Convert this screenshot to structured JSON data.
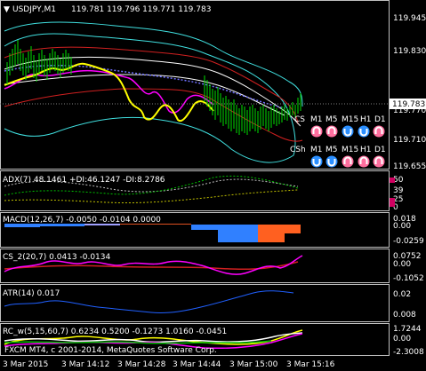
{
  "header": {
    "symbol": "USDJPY,M1",
    "ohlc": "119.781 119.796 119.771 119.783"
  },
  "price_axis": {
    "ticks": [
      "119.945",
      "119.830",
      "119.770",
      "119.710",
      "119.655"
    ],
    "current_price": "119.783",
    "current_price_bg": "#ffffff"
  },
  "indicator_panel": {
    "cs_label": "CS",
    "csh_label": "CSh",
    "timeframes": [
      "M1",
      "M5",
      "M15",
      "H1",
      "D1"
    ],
    "cs_arrows": [
      "up",
      "up",
      "down",
      "down",
      "up"
    ],
    "csh_arrows": [
      "down",
      "down",
      "up",
      "up",
      "up"
    ],
    "up_color": "#ff6e9e",
    "down_color": "#2b8fff"
  },
  "subwindows": {
    "adx": {
      "label": "ADX(7) 48.1461 +DI:46.1247 -DI:8.2786",
      "ticks": [
        "50",
        "39",
        "25",
        "0"
      ]
    },
    "macd": {
      "label": "MACD(12,26,7) -0.0050 -0.0104 0.0000",
      "ticks": [
        "0.018",
        "0.00",
        "-0.0259"
      ]
    },
    "cs": {
      "label": "CS_2(20,7) 0.0413 -0.0134",
      "ticks": [
        "0.0752",
        "0.00",
        "-0.1052"
      ]
    },
    "atr": {
      "label": "ATR(14) 0.017",
      "ticks": [
        "0.02",
        "0.008"
      ]
    },
    "rc": {
      "label": "RC_w(5,15,60,7) 0.6234 0.5200 -0.1273 1.0160 -0.0451",
      "ticks": [
        "1.7244",
        "0.00",
        "-2.3008"
      ]
    }
  },
  "watermark": "FXCM MT4, c 2001-2014, MetaQuotes Software Corp.",
  "time_axis": [
    "3 Mar 2015",
    "3 Mar 14:12",
    "3 Mar 14:28",
    "3 Mar 14:44",
    "3 Mar 15:00",
    "3 Mar 15:16"
  ]
}
